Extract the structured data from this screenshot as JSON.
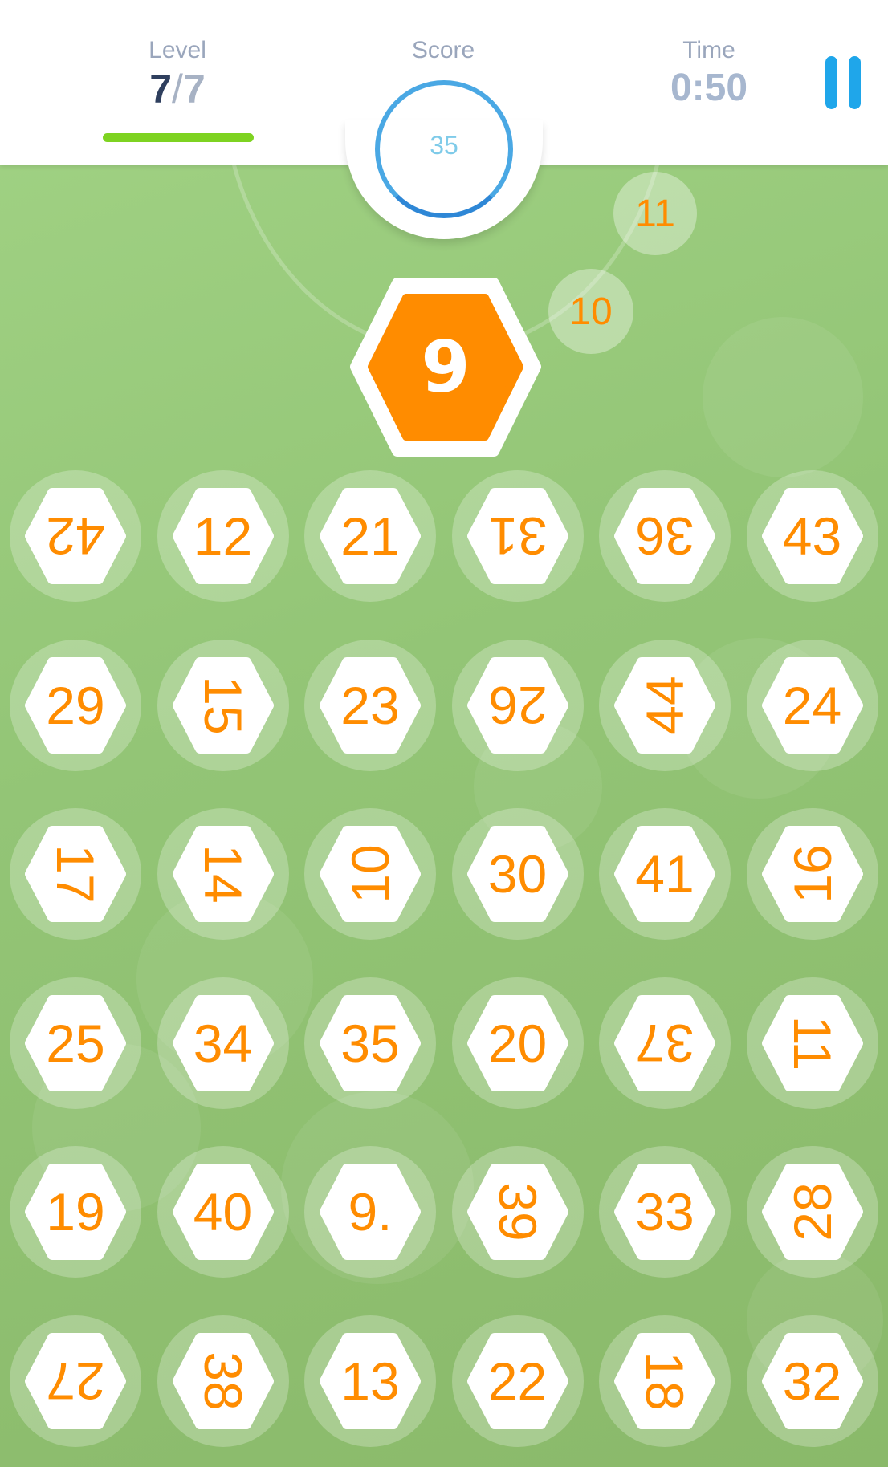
{
  "header": {
    "level_label": "Level",
    "level_current": "7",
    "level_separator": "/",
    "level_total": "7",
    "score_label": "Score",
    "score_value": "35",
    "time_label": "Time",
    "time_value": "0:50"
  },
  "current_target": "9",
  "upcoming": [
    "10",
    "11"
  ],
  "grid": [
    [
      "42",
      "12",
      "21",
      "31",
      "36",
      "43"
    ],
    [
      "29",
      "15",
      "23",
      "26",
      "44",
      "24"
    ],
    [
      "17",
      "14",
      "10",
      "30",
      "41",
      "16"
    ],
    [
      "25",
      "34",
      "35",
      "20",
      "37",
      "11"
    ],
    [
      "19",
      "40",
      "9.",
      "39",
      "33",
      "28"
    ],
    [
      "27",
      "38",
      "13",
      "22",
      "18",
      "32"
    ]
  ],
  "colors": {
    "background": "#93c576",
    "accent_orange": "#ff8c00",
    "level_bar": "#7ed321",
    "pause_icon": "#1fa6ea",
    "score_ring": "#4aa8e4"
  }
}
